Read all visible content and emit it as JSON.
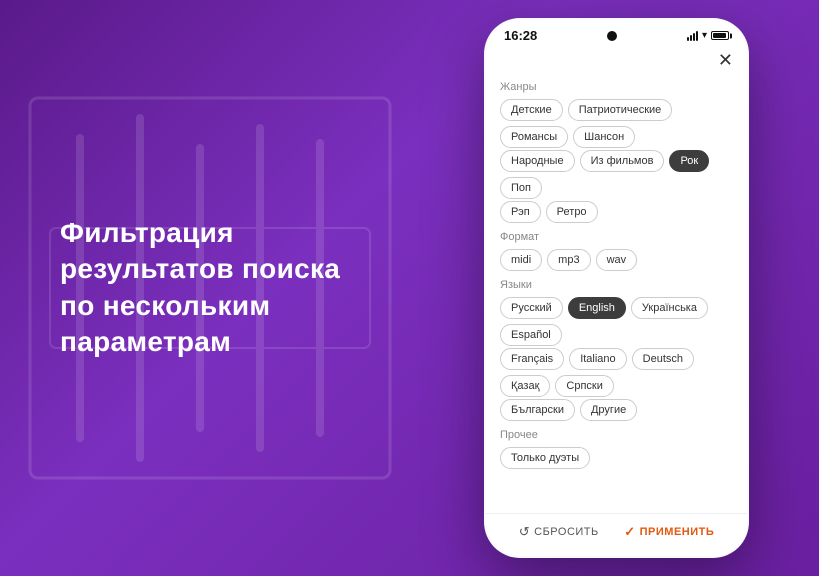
{
  "background": {
    "gradient_start": "#5a1a8a",
    "gradient_end": "#7b2fbe"
  },
  "left_text": {
    "line1": "Фильтрация",
    "line2": "результатов поиска",
    "line3": "по нескольким",
    "line4": "параметрам"
  },
  "phone": {
    "status_bar": {
      "time": "16:28"
    },
    "sections": [
      {
        "label": "Жанры",
        "tags": [
          {
            "text": "Детские",
            "active": false
          },
          {
            "text": "Патриотические",
            "active": false
          },
          {
            "text": "Романсы",
            "active": false
          },
          {
            "text": "Шансон",
            "active": false
          },
          {
            "text": "Народные",
            "active": false
          },
          {
            "text": "Из фильмов",
            "active": false
          },
          {
            "text": "Рок",
            "active": true
          },
          {
            "text": "Поп",
            "active": false
          },
          {
            "text": "Рэп",
            "active": false
          },
          {
            "text": "Ретро",
            "active": false
          }
        ]
      },
      {
        "label": "Формат",
        "tags": [
          {
            "text": "midi",
            "active": false
          },
          {
            "text": "mp3",
            "active": false
          },
          {
            "text": "wav",
            "active": false
          }
        ]
      },
      {
        "label": "Языки",
        "tags": [
          {
            "text": "Русский",
            "active": false
          },
          {
            "text": "English",
            "active": true
          },
          {
            "text": "Українська",
            "active": false
          },
          {
            "text": "Español",
            "active": false
          },
          {
            "text": "Français",
            "active": false
          },
          {
            "text": "Italiano",
            "active": false
          },
          {
            "text": "Deutsch",
            "active": false
          },
          {
            "text": "Қазақ",
            "active": false
          },
          {
            "text": "Српски",
            "active": false
          },
          {
            "text": "Български",
            "active": false
          },
          {
            "text": "Другие",
            "active": false
          }
        ]
      },
      {
        "label": "Прочее",
        "tags": [
          {
            "text": "Только дуэты",
            "active": false
          }
        ]
      }
    ],
    "bottom": {
      "reset_label": "СБРОСИТЬ",
      "apply_label": "ПРИМЕНИТЬ"
    }
  }
}
